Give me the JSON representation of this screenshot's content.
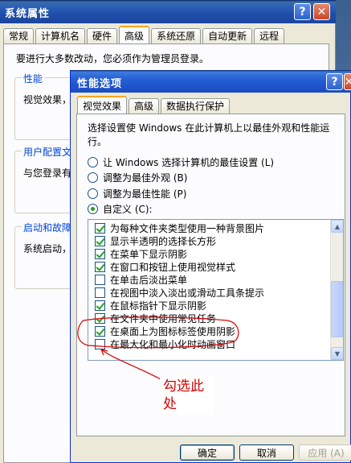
{
  "back_window": {
    "title": "系统属性",
    "help_glyph": "?",
    "close_glyph": "✕",
    "tabs": [
      "常规",
      "计算机名",
      "硬件",
      "高级",
      "系统还原",
      "自动更新",
      "远程"
    ],
    "active_tab": "高级",
    "admin_note": "要进行大多数改动，您必须作为管理员登录。",
    "groups": [
      {
        "title": "性能",
        "text": "视觉效果，"
      },
      {
        "title": "用户配置文",
        "text": "与您登录有"
      },
      {
        "title": "启动和故障",
        "text": "系统启动，"
      }
    ]
  },
  "front_window": {
    "title": "性能选项",
    "help_glyph": "?",
    "close_glyph": "✕",
    "tabs": [
      "视觉效果",
      "高级",
      "数据执行保护"
    ],
    "active_tab": "视觉效果",
    "description": "选择设置使 Windows 在此计算机上以最佳外观和性能运行。",
    "radio_options": [
      {
        "label": "让 Windows 选择计算机的最佳设置 (L)",
        "selected": false
      },
      {
        "label": "调整为最佳外观 (B)",
        "selected": false
      },
      {
        "label": "调整为最佳性能 (P)",
        "selected": false
      },
      {
        "label": "自定义 (C):",
        "selected": true
      }
    ],
    "list_items": [
      {
        "label": "为每种文件夹类型使用一种背景图片",
        "checked": true
      },
      {
        "label": "显示半透明的选择长方形",
        "checked": true
      },
      {
        "label": "在菜单下显示阴影",
        "checked": true
      },
      {
        "label": "在窗口和按钮上使用视觉样式",
        "checked": true
      },
      {
        "label": "在单击后淡出菜单",
        "checked": false
      },
      {
        "label": "在视图中淡入淡出或滑动工具条提示",
        "checked": false
      },
      {
        "label": "在鼠标指针下显示阴影",
        "checked": true
      },
      {
        "label": "在文件夹中使用常见任务",
        "checked": true
      },
      {
        "label": "在桌面上为图标标签使用阴影",
        "checked": true
      },
      {
        "label": "在最大化和最小化时动画窗口",
        "checked": false
      }
    ],
    "scroll_up_glyph": "▲",
    "scroll_down_glyph": "▼",
    "buttons": {
      "ok": "确定",
      "cancel": "取消",
      "apply": "应用 (A)"
    }
  },
  "annotation": {
    "text": "勾选此处",
    "color": "#d80000"
  },
  "colors": {
    "title_bar": "#1f55cc",
    "dialog_bg": "#ece9d8",
    "check_green": "#21a121",
    "group_title_blue": "#0046d5"
  }
}
